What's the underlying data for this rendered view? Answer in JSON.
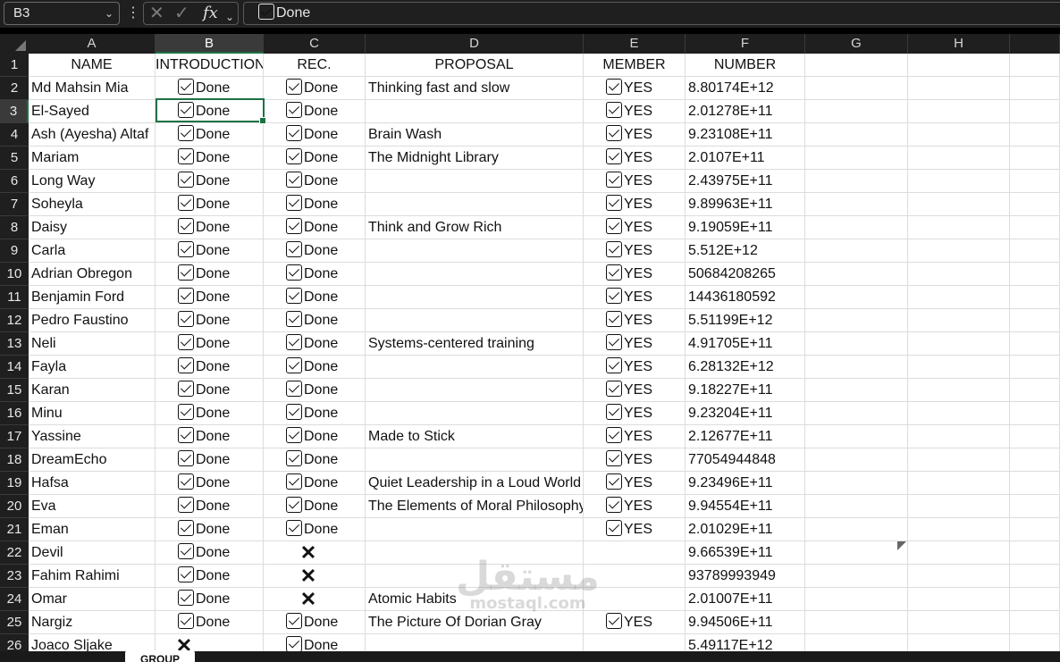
{
  "formula_bar": {
    "name_box": "B3",
    "formula_icon": "fx",
    "formula_value": "Done"
  },
  "columns": [
    {
      "letter": "A",
      "header": "NAME"
    },
    {
      "letter": "B",
      "header": "INTRODUCTION"
    },
    {
      "letter": "C",
      "header": "REC."
    },
    {
      "letter": "D",
      "header": "PROPOSAL"
    },
    {
      "letter": "E",
      "header": "MEMBER"
    },
    {
      "letter": "F",
      "header": "NUMBER"
    },
    {
      "letter": "G",
      "header": ""
    },
    {
      "letter": "H",
      "header": ""
    }
  ],
  "selected_cell": "B3",
  "done_label": "Done",
  "yes_label": "YES",
  "rows": [
    {
      "num": "2",
      "name": "Md Mahsin Mia",
      "intro": "done",
      "rec": "done",
      "proposal": "Thinking fast and slow",
      "member": "yes",
      "number": "8.80174E+12"
    },
    {
      "num": "3",
      "name": "El-Sayed",
      "intro": "done",
      "rec": "done",
      "proposal": "",
      "member": "yes",
      "number": "2.01278E+11"
    },
    {
      "num": "4",
      "name": "Ash (Ayesha) Altaf",
      "intro": "done",
      "rec": "done",
      "proposal": "Brain Wash",
      "member": "yes",
      "number": "9.23108E+11"
    },
    {
      "num": "5",
      "name": "Mariam",
      "intro": "done",
      "rec": "done",
      "proposal": "The Midnight Library",
      "member": "yes",
      "number": "2.0107E+11"
    },
    {
      "num": "6",
      "name": "Long Way",
      "intro": "done",
      "rec": "done",
      "proposal": "",
      "member": "yes",
      "number": "2.43975E+11"
    },
    {
      "num": "7",
      "name": "Soheyla",
      "intro": "done",
      "rec": "done",
      "proposal": "",
      "member": "yes",
      "number": "9.89963E+11"
    },
    {
      "num": "8",
      "name": "Daisy",
      "intro": "done",
      "rec": "done",
      "proposal": "Think and Grow Rich",
      "member": "yes",
      "number": "9.19059E+11"
    },
    {
      "num": "9",
      "name": "Carla",
      "intro": "done",
      "rec": "done",
      "proposal": "",
      "member": "yes",
      "number": "5.512E+12"
    },
    {
      "num": "10",
      "name": "Adrian Obregon",
      "intro": "done",
      "rec": "done",
      "proposal": "",
      "member": "yes",
      "number": "50684208265"
    },
    {
      "num": "11",
      "name": "Benjamin Ford",
      "intro": "done",
      "rec": "done",
      "proposal": "",
      "member": "yes",
      "number": "14436180592"
    },
    {
      "num": "12",
      "name": "Pedro Faustino",
      "intro": "done",
      "rec": "done",
      "proposal": "",
      "member": "yes",
      "number": "5.51199E+12"
    },
    {
      "num": "13",
      "name": "Neli",
      "intro": "done",
      "rec": "done",
      "proposal": "Systems-centered training",
      "member": "yes",
      "number": "4.91705E+11"
    },
    {
      "num": "14",
      "name": "Fayla",
      "intro": "done",
      "rec": "done",
      "proposal": "",
      "member": "yes",
      "number": "6.28132E+12"
    },
    {
      "num": "15",
      "name": "Karan",
      "intro": "done",
      "rec": "done",
      "proposal": "",
      "member": "yes",
      "number": "9.18227E+11"
    },
    {
      "num": "16",
      "name": "Minu",
      "intro": "done",
      "rec": "done",
      "proposal": "",
      "member": "yes",
      "number": "9.23204E+11"
    },
    {
      "num": "17",
      "name": "Yassine",
      "intro": "done",
      "rec": "done",
      "proposal": "Made to Stick",
      "member": "yes",
      "number": "2.12677E+11"
    },
    {
      "num": "18",
      "name": "DreamEcho",
      "intro": "done",
      "rec": "done",
      "proposal": "",
      "member": "yes",
      "number": "77054944848"
    },
    {
      "num": "19",
      "name": "Hafsa",
      "intro": "done",
      "rec": "done",
      "proposal": "Quiet Leadership in a Loud World",
      "member": "yes",
      "number": "9.23496E+11"
    },
    {
      "num": "20",
      "name": "Eva",
      "intro": "done",
      "rec": "done",
      "proposal": "The Elements of Moral Philosophy",
      "member": "yes",
      "number": "9.94554E+11"
    },
    {
      "num": "21",
      "name": "Eman",
      "intro": "done",
      "rec": "done",
      "proposal": "",
      "member": "yes",
      "number": "2.01029E+11"
    },
    {
      "num": "22",
      "name": "Devil",
      "intro": "done",
      "rec": "x",
      "proposal": "",
      "member": "",
      "number": "9.66539E+11"
    },
    {
      "num": "23",
      "name": "Fahim Rahimi",
      "intro": "done",
      "rec": "x",
      "proposal": "",
      "member": "",
      "number": "93789993949"
    },
    {
      "num": "24",
      "name": "Omar",
      "intro": "done",
      "rec": "x",
      "proposal": "Atomic Habits",
      "member": "",
      "number": "2.01007E+11"
    },
    {
      "num": "25",
      "name": "Nargiz",
      "intro": "done",
      "rec": "done",
      "proposal": "The Picture Of Dorian Gray",
      "member": "yes",
      "number": "9.94506E+11"
    },
    {
      "num": "26",
      "name": "Joaco Sljake",
      "intro": "x",
      "rec": "done",
      "proposal": "",
      "member": "",
      "number": "5.49117E+12"
    }
  ],
  "watermark": {
    "arabic": "مستقل",
    "latin": "mostaql.com"
  },
  "sheet_tab": "GROUP"
}
